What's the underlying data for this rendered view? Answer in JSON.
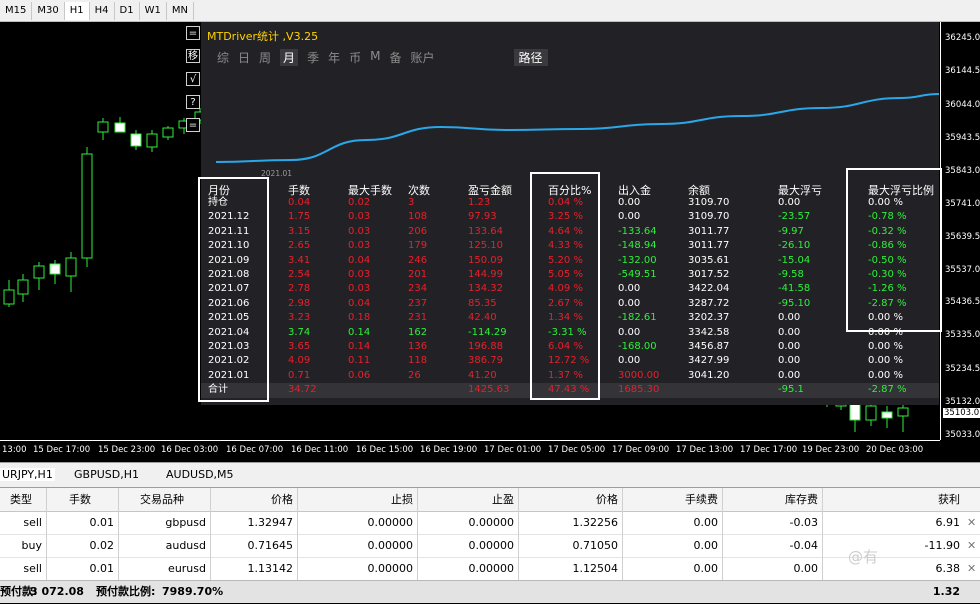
{
  "timeframes": [
    "M15",
    "M30",
    "H1",
    "H4",
    "D1",
    "W1",
    "MN"
  ],
  "active_timeframe": "H1",
  "price_axis": {
    "labels": [
      "36245.0",
      "36144.5",
      "36044.0",
      "35943.5",
      "35843.0",
      "35741.0",
      "35639.5",
      "35537.0",
      "35436.5",
      "35335.0",
      "35234.5",
      "35132.0",
      "35103.0",
      "35033.0"
    ],
    "highlight": "35103.0"
  },
  "time_axis": [
    "13:00",
    "15 Dec 17:00",
    "15 Dec 23:00",
    "16 Dec 03:00",
    "16 Dec 07:00",
    "16 Dec 11:00",
    "16 Dec 15:00",
    "16 Dec 19:00",
    "17 Dec 01:00",
    "17 Dec 05:00",
    "17 Dec 09:00",
    "17 Dec 13:00",
    "17 Dec 17:00",
    "19 Dec 23:00",
    "20 Dec 03:00"
  ],
  "side_buttons": [
    "=",
    "移",
    "√",
    "?",
    "="
  ],
  "panel": {
    "title": "MTDriver统计 ,V3.25",
    "tabs": [
      "综",
      "日",
      "周",
      "月",
      "季",
      "年",
      "币",
      "M",
      "备",
      "账户"
    ],
    "active_tab": "月",
    "path_tab": "路径",
    "curve_start_label": "2021.01",
    "curve_color": "#2aa7e8",
    "headers": [
      "月份",
      "手数",
      "最大手数",
      "次数",
      "盈亏金额",
      "百分比%",
      "出入金",
      "余额",
      "最大浮亏",
      "最大浮亏比例"
    ],
    "rows": [
      {
        "month": "持仓",
        "lots": "0.04",
        "max_lots": "0.02",
        "count": "3",
        "pnl": "1.23",
        "pct": "0.04 %",
        "flow": "0.00",
        "balance": "3109.70",
        "max_dd": "0.00",
        "max_dd_pct": "0.00 %",
        "tone": "r"
      },
      {
        "month": "2021.12",
        "lots": "1.75",
        "max_lots": "0.03",
        "count": "108",
        "pnl": "97.93",
        "pct": "3.25 %",
        "flow": "0.00",
        "balance": "3109.70",
        "max_dd": "-23.57",
        "max_dd_pct": "-0.78 %",
        "tone": "r"
      },
      {
        "month": "2021.11",
        "lots": "3.15",
        "max_lots": "0.03",
        "count": "206",
        "pnl": "133.64",
        "pct": "4.64 %",
        "flow": "-133.64",
        "balance": "3011.77",
        "max_dd": "-9.97",
        "max_dd_pct": "-0.32 %",
        "tone": "r"
      },
      {
        "month": "2021.10",
        "lots": "2.65",
        "max_lots": "0.03",
        "count": "179",
        "pnl": "125.10",
        "pct": "4.33 %",
        "flow": "-148.94",
        "balance": "3011.77",
        "max_dd": "-26.10",
        "max_dd_pct": "-0.86 %",
        "tone": "r"
      },
      {
        "month": "2021.09",
        "lots": "3.41",
        "max_lots": "0.04",
        "count": "246",
        "pnl": "150.09",
        "pct": "5.20 %",
        "flow": "-132.00",
        "balance": "3035.61",
        "max_dd": "-15.04",
        "max_dd_pct": "-0.50 %",
        "tone": "r"
      },
      {
        "month": "2021.08",
        "lots": "2.54",
        "max_lots": "0.03",
        "count": "201",
        "pnl": "144.99",
        "pct": "5.05 %",
        "flow": "-549.51",
        "balance": "3017.52",
        "max_dd": "-9.58",
        "max_dd_pct": "-0.30 %",
        "tone": "r"
      },
      {
        "month": "2021.07",
        "lots": "2.78",
        "max_lots": "0.03",
        "count": "234",
        "pnl": "134.32",
        "pct": "4.09 %",
        "flow": "0.00",
        "balance": "3422.04",
        "max_dd": "-41.58",
        "max_dd_pct": "-1.26 %",
        "tone": "r"
      },
      {
        "month": "2021.06",
        "lots": "2.98",
        "max_lots": "0.04",
        "count": "237",
        "pnl": "85.35",
        "pct": "2.67 %",
        "flow": "0.00",
        "balance": "3287.72",
        "max_dd": "-95.10",
        "max_dd_pct": "-2.87 %",
        "tone": "r"
      },
      {
        "month": "2021.05",
        "lots": "3.23",
        "max_lots": "0.18",
        "count": "231",
        "pnl": "42.40",
        "pct": "1.34 %",
        "flow": "-182.61",
        "balance": "3202.37",
        "max_dd": "0.00",
        "max_dd_pct": "0.00 %",
        "tone": "r"
      },
      {
        "month": "2021.04",
        "lots": "3.74",
        "max_lots": "0.14",
        "count": "162",
        "pnl": "-114.29",
        "pct": "-3.31 %",
        "flow": "0.00",
        "balance": "3342.58",
        "max_dd": "0.00",
        "max_dd_pct": "0.00 %",
        "tone": "g"
      },
      {
        "month": "2021.03",
        "lots": "3.65",
        "max_lots": "0.14",
        "count": "136",
        "pnl": "196.88",
        "pct": "6.04 %",
        "flow": "-168.00",
        "balance": "3456.87",
        "max_dd": "0.00",
        "max_dd_pct": "0.00 %",
        "tone": "r"
      },
      {
        "month": "2021.02",
        "lots": "4.09",
        "max_lots": "0.11",
        "count": "118",
        "pnl": "386.79",
        "pct": "12.72 %",
        "flow": "0.00",
        "balance": "3427.99",
        "max_dd": "0.00",
        "max_dd_pct": "0.00 %",
        "tone": "r"
      },
      {
        "month": "2021.01",
        "lots": "0.71",
        "max_lots": "0.06",
        "count": "26",
        "pnl": "41.20",
        "pct": "1.37 %",
        "flow": "3000.00",
        "balance": "3041.20",
        "max_dd": "0.00",
        "max_dd_pct": "0.00 %",
        "tone": "r"
      }
    ],
    "total": {
      "month": "合计",
      "lots": "34.72",
      "max_lots": "",
      "count": "",
      "pnl": "1425.63",
      "pct": "47.43 %",
      "flow": "1685.30",
      "balance": "",
      "max_dd": "-95.1",
      "max_dd_pct": "-2.87 %"
    }
  },
  "symbol_tabs": [
    "URJPY,H1",
    "GBPUSD,H1",
    "AUDUSD,M5"
  ],
  "active_symbol_tab": "URJPY,H1",
  "trade_table": {
    "headers": [
      "类型",
      "手数",
      "交易品种",
      "价格",
      "止损",
      "止盈",
      "价格",
      "手续费",
      "库存费",
      "获利"
    ],
    "rows": [
      [
        "sell",
        "0.01",
        "gbpusd",
        "1.32947",
        "0.00000",
        "0.00000",
        "1.32256",
        "0.00",
        "-0.03",
        "6.91"
      ],
      [
        "buy",
        "0.02",
        "audusd",
        "0.71645",
        "0.00000",
        "0.00000",
        "0.71050",
        "0.00",
        "-0.04",
        "-11.90"
      ],
      [
        "sell",
        "0.01",
        "eurusd",
        "1.13142",
        "0.00000",
        "0.00000",
        "1.12504",
        "0.00",
        "0.00",
        "6.38"
      ]
    ]
  },
  "balance_bar": {
    "margin_label": "预付款:",
    "margin_value": "3 072.08",
    "margin_level_label": "预付款比例:",
    "margin_level_value": "7989.70%",
    "total_profit": "1.32"
  },
  "watermark": "@有"
}
